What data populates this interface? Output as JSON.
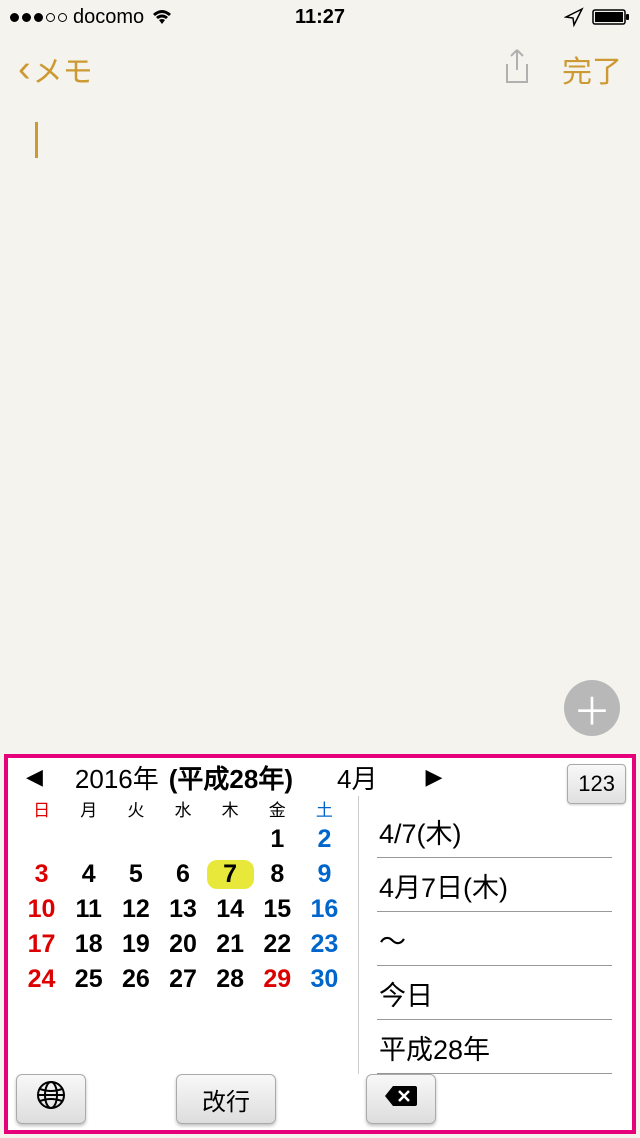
{
  "status": {
    "carrier": "docomo",
    "time": "11:27"
  },
  "nav": {
    "back_label": "メモ",
    "done_label": "完了"
  },
  "keyboard": {
    "year": "2016年",
    "era": "(平成28年)",
    "month": "4月",
    "numkey": "123",
    "weekdays": [
      "日",
      "月",
      "火",
      "水",
      "木",
      "金",
      "土"
    ],
    "days": [
      {
        "n": "",
        "cls": "empty"
      },
      {
        "n": "",
        "cls": "empty"
      },
      {
        "n": "",
        "cls": "empty"
      },
      {
        "n": "",
        "cls": "empty"
      },
      {
        "n": "",
        "cls": "empty"
      },
      {
        "n": "1",
        "cls": ""
      },
      {
        "n": "2",
        "cls": "sat"
      },
      {
        "n": "3",
        "cls": "sun"
      },
      {
        "n": "4",
        "cls": ""
      },
      {
        "n": "5",
        "cls": ""
      },
      {
        "n": "6",
        "cls": ""
      },
      {
        "n": "7",
        "cls": "selected"
      },
      {
        "n": "8",
        "cls": ""
      },
      {
        "n": "9",
        "cls": "sat"
      },
      {
        "n": "10",
        "cls": "sun"
      },
      {
        "n": "11",
        "cls": ""
      },
      {
        "n": "12",
        "cls": ""
      },
      {
        "n": "13",
        "cls": ""
      },
      {
        "n": "14",
        "cls": ""
      },
      {
        "n": "15",
        "cls": ""
      },
      {
        "n": "16",
        "cls": "sat"
      },
      {
        "n": "17",
        "cls": "sun"
      },
      {
        "n": "18",
        "cls": ""
      },
      {
        "n": "19",
        "cls": ""
      },
      {
        "n": "20",
        "cls": ""
      },
      {
        "n": "21",
        "cls": ""
      },
      {
        "n": "22",
        "cls": ""
      },
      {
        "n": "23",
        "cls": "sat"
      },
      {
        "n": "24",
        "cls": "sun"
      },
      {
        "n": "25",
        "cls": ""
      },
      {
        "n": "26",
        "cls": ""
      },
      {
        "n": "27",
        "cls": ""
      },
      {
        "n": "28",
        "cls": ""
      },
      {
        "n": "29",
        "cls": "holiday"
      },
      {
        "n": "30",
        "cls": "sat"
      }
    ],
    "suggestions": [
      "4/7(木)",
      "4月7日(木)",
      "〜",
      "今日",
      "平成28年"
    ],
    "return_label": "改行"
  }
}
